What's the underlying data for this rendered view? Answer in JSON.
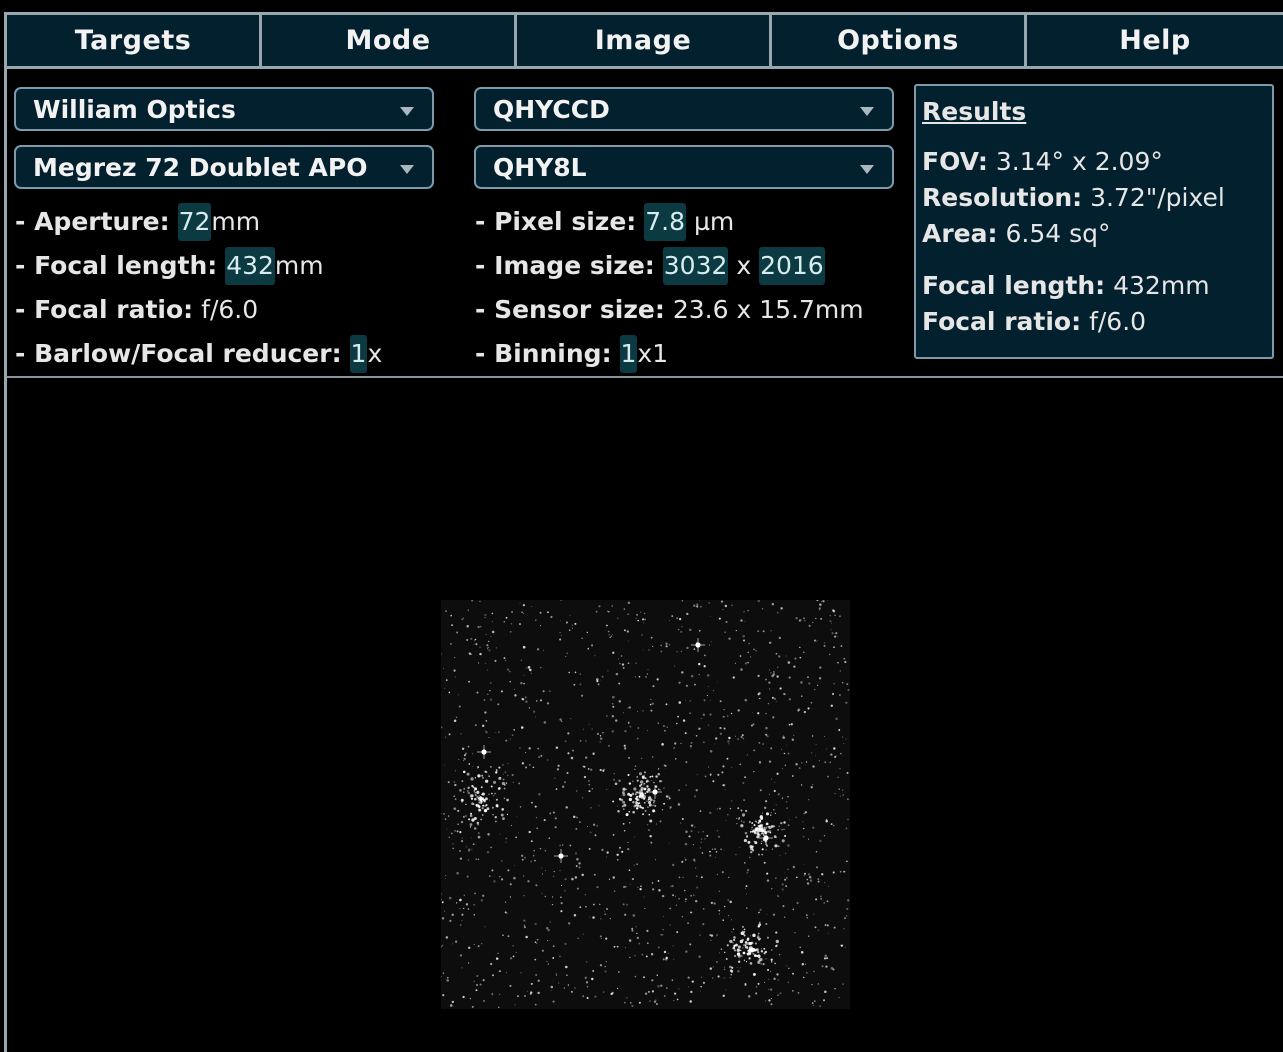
{
  "menu": {
    "items": [
      "Targets",
      "Mode",
      "Image",
      "Options",
      "Help"
    ]
  },
  "telescope": {
    "brand": "William Optics",
    "model": "Megrez 72 Doublet APO",
    "aperture": {
      "label": "- Aperture:",
      "value": "72",
      "unit": "mm"
    },
    "focal_length": {
      "label": "- Focal length:",
      "value": "432",
      "unit": "mm"
    },
    "focal_ratio": {
      "label": "- Focal ratio:",
      "value": "f/6.0"
    },
    "barlow": {
      "label": "- Barlow/Focal reducer:",
      "value": "1",
      "unit": "x"
    }
  },
  "camera": {
    "brand": "QHYCCD",
    "model": "QHY8L",
    "pixel_size": {
      "label": "- Pixel size:",
      "value": "7.8",
      "unit": "µm"
    },
    "image_size": {
      "label": "- Image size:",
      "width": "3032",
      "sep": "x",
      "height": "2016"
    },
    "sensor_size": {
      "label": "- Sensor size:",
      "value": "23.6 x 15.7mm"
    },
    "binning": {
      "label": "- Binning:",
      "value": "1",
      "unit": "x1"
    }
  },
  "results": {
    "title": "Results",
    "fov": {
      "label": "FOV:",
      "value": "3.14° x 2.09°"
    },
    "resolution": {
      "label": "Resolution:",
      "value": "3.72\"/pixel"
    },
    "area": {
      "label": "Area:",
      "value": "6.54 sq°"
    },
    "focal_length": {
      "label": "Focal length:",
      "value": "432mm"
    },
    "focal_ratio": {
      "label": "Focal ratio:",
      "value": "f/6.0"
    }
  },
  "colors": {
    "panel_bg": "#03202e",
    "border": "#9aa6ae",
    "value_bg": "#0b3a43"
  },
  "preview": {
    "icon": "star-field-image"
  }
}
